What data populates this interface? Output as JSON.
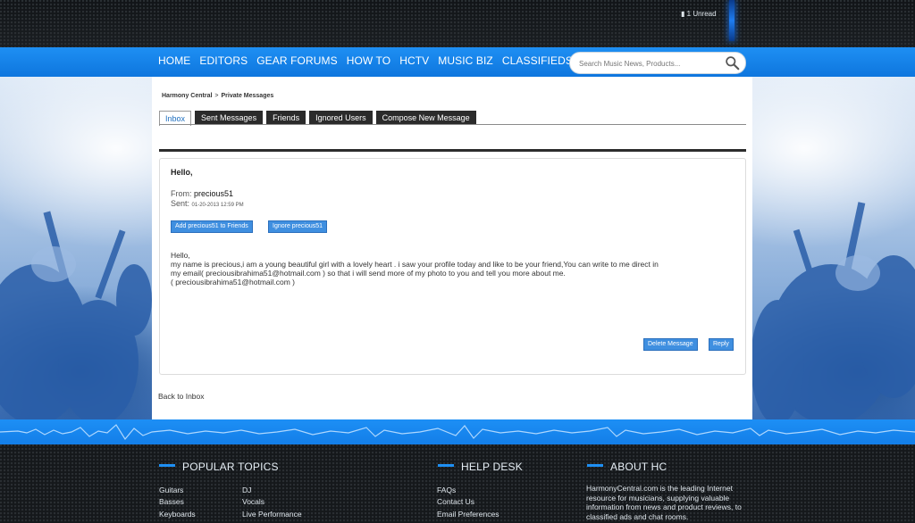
{
  "header": {
    "unread": "1 Unread"
  },
  "nav": {
    "items": [
      "HOME",
      "EDITORS",
      "GEAR FORUMS",
      "HOW TO",
      "HCTV",
      "MUSIC BIZ",
      "CLASSIFIEDS"
    ],
    "search_placeholder": "Search Music News, Products..."
  },
  "breadcrumb": {
    "root": "Harmony Central",
    "separator": ">",
    "current": "Private Messages"
  },
  "tabs": [
    "Inbox",
    "Sent Messages",
    "Friends",
    "Ignored Users",
    "Compose New Message"
  ],
  "message": {
    "title": "Hello,",
    "from_label": "From:",
    "from_user": "precious51",
    "sent_label": "Sent:",
    "sent_time": "01-20-2013 12:59 PM",
    "add_friend_button": "Add precious51 to Friends",
    "ignore_button": "Ignore precious51",
    "body_lines": [
      "Hello,",
      "my name is precious,i am a young beautiful girl with a lovely heart . i saw your profile today and like to be your friend,You can write to me direct in",
      "my email( preciousibrahima51@hotmail.com ) so that i will send more of my photo to you and tell you more about me.",
      "( preciousibrahima51@hotmail.com )"
    ],
    "delete_button": "Delete Message",
    "reply_button": "Reply"
  },
  "back_link": "Back to Inbox",
  "footer": {
    "popular_title": "POPULAR TOPICS",
    "popular_col1": [
      "Guitars",
      "Basses",
      "Keyboards"
    ],
    "popular_col2": [
      "DJ",
      "Vocals",
      "Live Performance"
    ],
    "help_title": "HELP DESK",
    "help_links": [
      "FAQs",
      "Contact Us",
      "Email Preferences"
    ],
    "about_title": "ABOUT HC",
    "about_text": "HarmonyCentral.com is the leading Internet resource for musicians, supplying valuable information from news and product reviews, to classified ads and chat rooms."
  },
  "colors": {
    "accent": "#1e8ff3",
    "dark": "#15181b",
    "button": "#3f8fe0"
  }
}
